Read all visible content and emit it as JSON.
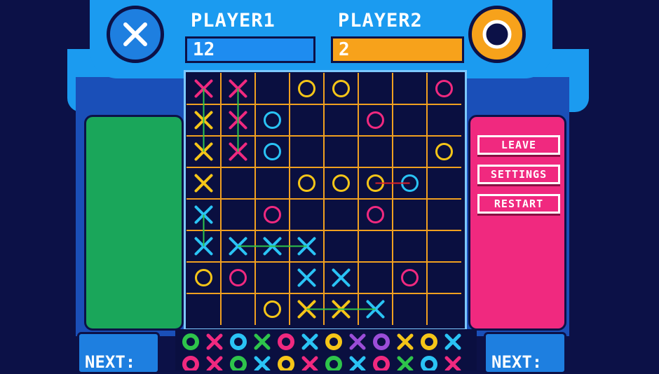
{
  "players": {
    "p1": {
      "name": "PLAYER1",
      "score": "12",
      "symbol": "x-emblem-icon"
    },
    "p2": {
      "name": "PLAYER2",
      "score": "2",
      "symbol": "o-emblem-icon"
    }
  },
  "menu": {
    "leave": "LEAVE",
    "settings": "SETTINGS",
    "restart": "RESTART"
  },
  "next": {
    "left": "NEXT:",
    "right": "NEXT:"
  },
  "colors": {
    "grid": "#f0a020",
    "pink": "#f0297f",
    "yellow": "#f5c518",
    "cyan": "#2ac3f5",
    "line_green": "#2ec44b",
    "line_red": "#d8222a"
  },
  "board": {
    "rows": 8,
    "cols": 8,
    "pieces": [
      {
        "r": 0,
        "c": 0,
        "t": "X",
        "col": "pink"
      },
      {
        "r": 0,
        "c": 1,
        "t": "X",
        "col": "pink"
      },
      {
        "r": 0,
        "c": 3,
        "t": "O",
        "col": "yellow"
      },
      {
        "r": 0,
        "c": 4,
        "t": "O",
        "col": "yellow"
      },
      {
        "r": 0,
        "c": 7,
        "t": "O",
        "col": "pink"
      },
      {
        "r": 1,
        "c": 0,
        "t": "X",
        "col": "yellow"
      },
      {
        "r": 1,
        "c": 1,
        "t": "X",
        "col": "pink"
      },
      {
        "r": 1,
        "c": 2,
        "t": "O",
        "col": "cyan"
      },
      {
        "r": 1,
        "c": 5,
        "t": "O",
        "col": "pink"
      },
      {
        "r": 2,
        "c": 0,
        "t": "X",
        "col": "yellow"
      },
      {
        "r": 2,
        "c": 1,
        "t": "X",
        "col": "pink"
      },
      {
        "r": 2,
        "c": 2,
        "t": "O",
        "col": "cyan"
      },
      {
        "r": 2,
        "c": 7,
        "t": "O",
        "col": "yellow"
      },
      {
        "r": 3,
        "c": 0,
        "t": "X",
        "col": "yellow"
      },
      {
        "r": 3,
        "c": 3,
        "t": "O",
        "col": "yellow"
      },
      {
        "r": 3,
        "c": 4,
        "t": "O",
        "col": "yellow"
      },
      {
        "r": 3,
        "c": 5,
        "t": "O",
        "col": "yellow"
      },
      {
        "r": 3,
        "c": 6,
        "t": "O",
        "col": "cyan"
      },
      {
        "r": 4,
        "c": 0,
        "t": "X",
        "col": "cyan"
      },
      {
        "r": 4,
        "c": 2,
        "t": "O",
        "col": "pink"
      },
      {
        "r": 4,
        "c": 5,
        "t": "O",
        "col": "pink"
      },
      {
        "r": 5,
        "c": 0,
        "t": "X",
        "col": "cyan"
      },
      {
        "r": 5,
        "c": 1,
        "t": "X",
        "col": "cyan"
      },
      {
        "r": 5,
        "c": 2,
        "t": "X",
        "col": "cyan"
      },
      {
        "r": 5,
        "c": 3,
        "t": "X",
        "col": "cyan"
      },
      {
        "r": 6,
        "c": 0,
        "t": "O",
        "col": "yellow"
      },
      {
        "r": 6,
        "c": 1,
        "t": "O",
        "col": "pink"
      },
      {
        "r": 6,
        "c": 3,
        "t": "X",
        "col": "cyan"
      },
      {
        "r": 6,
        "c": 4,
        "t": "X",
        "col": "cyan"
      },
      {
        "r": 6,
        "c": 6,
        "t": "O",
        "col": "pink"
      },
      {
        "r": 7,
        "c": 2,
        "t": "O",
        "col": "yellow"
      },
      {
        "r": 7,
        "c": 3,
        "t": "X",
        "col": "yellow"
      },
      {
        "r": 7,
        "c": 4,
        "t": "X",
        "col": "yellow"
      },
      {
        "r": 7,
        "c": 5,
        "t": "X",
        "col": "cyan"
      }
    ],
    "lines": [
      {
        "from": [
          0,
          0
        ],
        "to": [
          2,
          0
        ],
        "col": "line_green"
      },
      {
        "from": [
          0,
          1
        ],
        "to": [
          2,
          1
        ],
        "col": "line_green"
      },
      {
        "from": [
          3,
          5
        ],
        "to": [
          3,
          6
        ],
        "col": "line_red"
      },
      {
        "from": [
          4,
          0
        ],
        "to": [
          5,
          0
        ],
        "col": "line_green"
      },
      {
        "from": [
          5,
          1
        ],
        "to": [
          5,
          3
        ],
        "col": "line_green"
      },
      {
        "from": [
          7,
          3
        ],
        "to": [
          7,
          5
        ],
        "col": "line_green"
      }
    ]
  },
  "queue": {
    "row1": [
      "O-green",
      "X-pink",
      "O-cyan",
      "X-green",
      "O-pink",
      "X-cyan",
      "O-yellow",
      "X-purple",
      "O-purple",
      "X-yellow",
      "O-yellow",
      "X-cyan"
    ],
    "row2": [
      "O-pink",
      "X-pink",
      "O-green",
      "X-cyan",
      "O-yellow",
      "X-pink",
      "O-green",
      "X-cyan",
      "O-pink",
      "X-green",
      "O-cyan",
      "X-pink"
    ]
  }
}
